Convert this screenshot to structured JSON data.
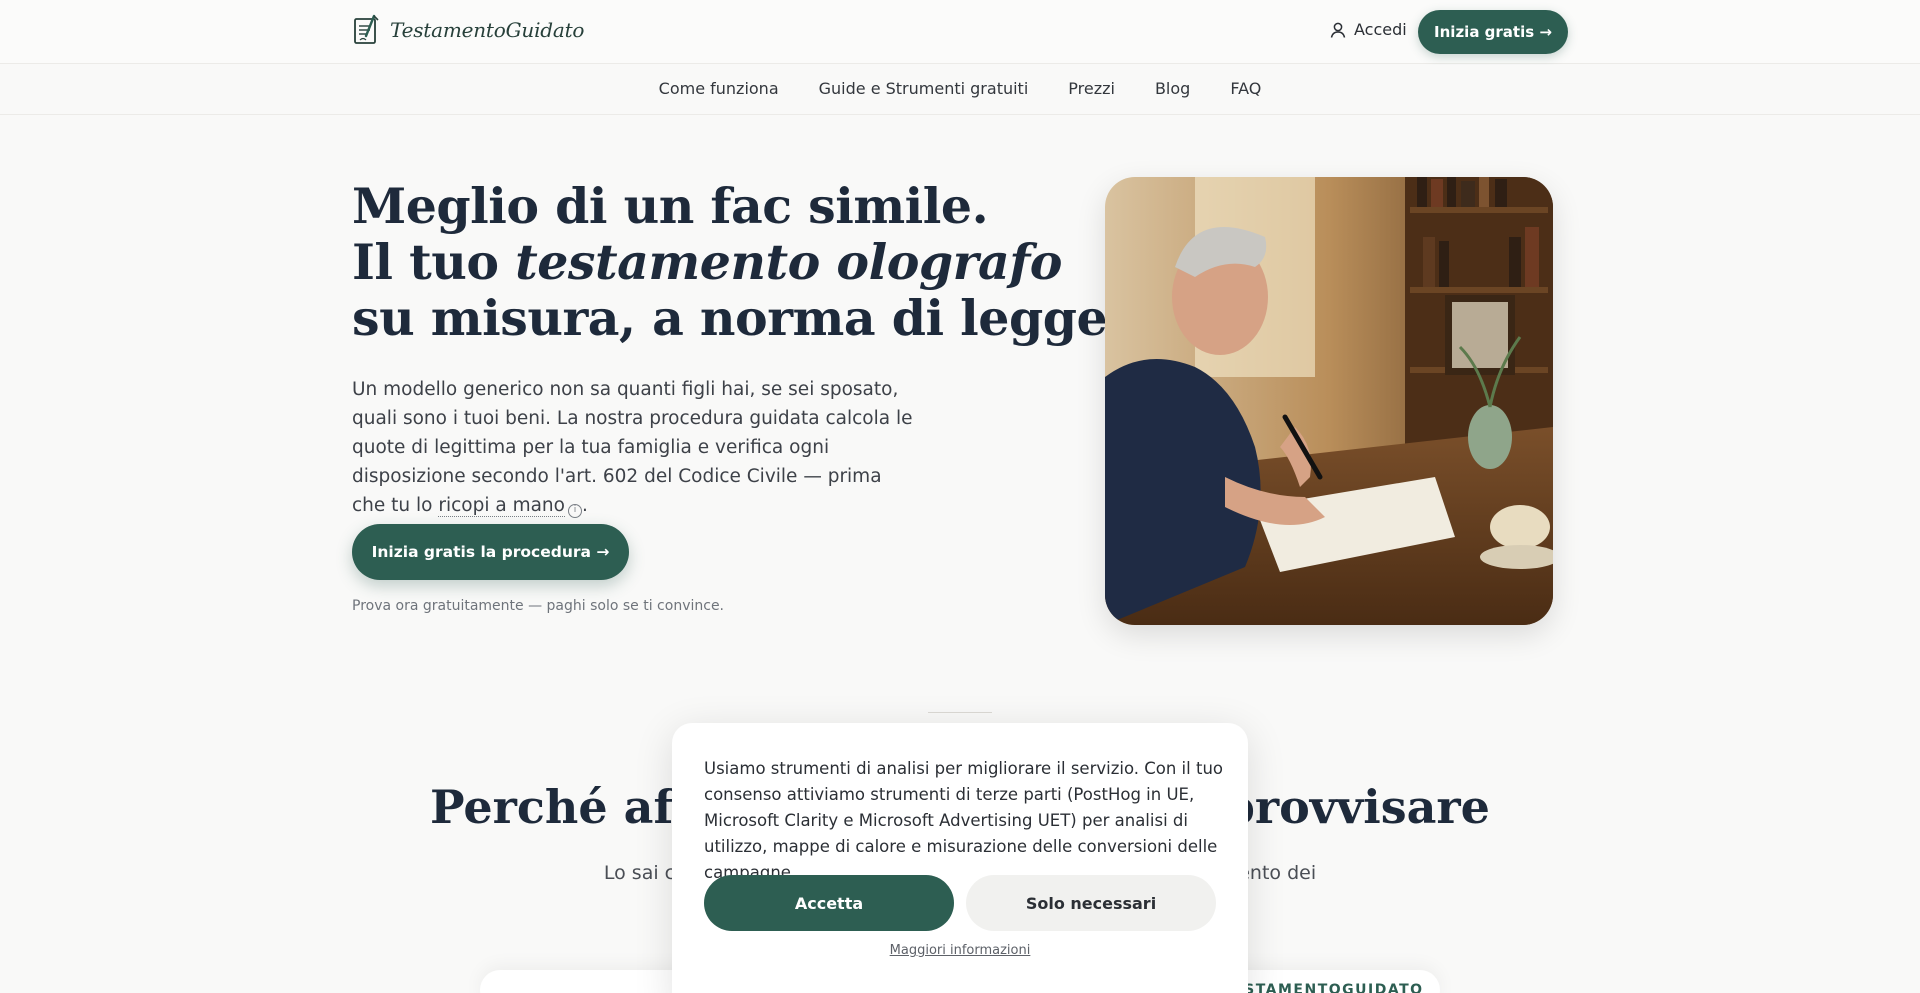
{
  "header": {
    "brand": "TestamentoGuidato",
    "login_label": "Accedi",
    "cta_label": "Inizia gratis →"
  },
  "nav": {
    "items": [
      "Come funziona",
      "Guide e Strumenti gratuiti",
      "Prezzi",
      "Blog",
      "FAQ"
    ]
  },
  "hero": {
    "title_line1": "Meglio di un fac simile.",
    "title_line2_prefix": "Il tuo ",
    "title_line2_em": "testamento olografo",
    "title_line3": "su misura, a norma di legge.",
    "body_text": "Un modello generico non sa quanti figli hai, se sei sposato, quali sono i tuoi beni. La nostra procedura guidata calcola le quote di legittima per la tua famiglia e verifica ogni disposizione secondo l'art. 602 del Codice Civile — prima che tu lo ",
    "body_link": "ricopi a mano",
    "body_end": ".",
    "cta_label": "Inizia gratis la procedura →",
    "note": "Prova ora gratuitamente — paghi solo se ti convince."
  },
  "section": {
    "title": "Perché affidarsi a noi e non improvvisare",
    "subtitle": "Lo sai che un testamento scritto male può causare liti e l'annullamento dei",
    "card_tag": "TESTAMENTOGUIDATO"
  },
  "cookie": {
    "text": "Usiamo strumenti di analisi per migliorare il servizio. Con il tuo consenso attiviamo strumenti di terze parti (PostHog in UE, Microsoft Clarity e Microsoft Advertising UET) per analisi di utilizzo, mappe di calore e misurazione delle conversioni delle campagne.",
    "accept_label": "Accetta",
    "necessary_label": "Solo necessari",
    "more_info_label": "Maggiori informazioni"
  },
  "colors": {
    "accent": "#2d5e52",
    "background": "#f9f9f8",
    "heading": "#1e2a3b"
  },
  "icons": {
    "logo": "document-pen-icon",
    "login": "user-icon",
    "info": "info-icon"
  }
}
